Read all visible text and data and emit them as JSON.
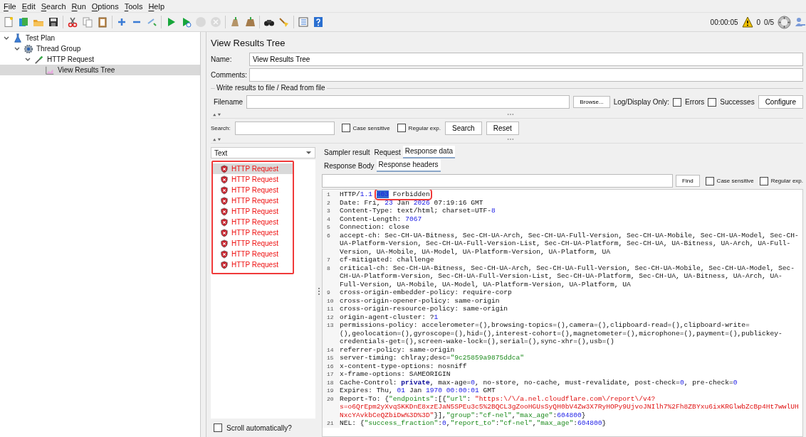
{
  "menu": [
    {
      "label": "File"
    },
    {
      "label": "Edit"
    },
    {
      "label": "Search"
    },
    {
      "label": "Run"
    },
    {
      "label": "Options"
    },
    {
      "label": "Tools"
    },
    {
      "label": "Help"
    }
  ],
  "toolbar_groups": [
    {
      "buttons": [
        {
          "kind": "new",
          "disabled": false
        },
        {
          "kind": "templates",
          "disabled": false
        },
        {
          "kind": "open",
          "disabled": false
        },
        {
          "kind": "save",
          "disabled": false
        }
      ]
    },
    {
      "buttons": [
        {
          "kind": "cut",
          "disabled": false
        },
        {
          "kind": "copy",
          "disabled": false
        },
        {
          "kind": "paste",
          "disabled": false
        }
      ]
    },
    {
      "buttons": [
        {
          "kind": "expand",
          "disabled": false
        },
        {
          "kind": "collapse",
          "disabled": false
        },
        {
          "kind": "toggle",
          "disabled": false
        }
      ]
    },
    {
      "buttons": [
        {
          "kind": "start",
          "disabled": false
        },
        {
          "kind": "start_no_timers",
          "disabled": false
        },
        {
          "kind": "stop",
          "disabled": true
        },
        {
          "kind": "shutdown",
          "disabled": true
        }
      ]
    },
    {
      "buttons": [
        {
          "kind": "clear",
          "disabled": false
        },
        {
          "kind": "clear_all",
          "disabled": false
        }
      ]
    },
    {
      "buttons": [
        {
          "kind": "search",
          "disabled": false
        },
        {
          "kind": "reset_search",
          "disabled": false
        }
      ]
    },
    {
      "buttons": [
        {
          "kind": "functions",
          "disabled": false
        },
        {
          "kind": "help",
          "disabled": false
        }
      ]
    }
  ],
  "status": {
    "elapsed": "00:00:05",
    "warnings": "0",
    "threads": "0/5"
  },
  "tree": [
    {
      "label": "Test Plan",
      "kind": "plan",
      "expanded": true,
      "selected": false,
      "children": [
        {
          "label": "Thread Group",
          "kind": "thread_group",
          "expanded": true,
          "selected": false,
          "children": [
            {
              "label": "HTTP Request",
              "kind": "sampler",
              "expanded": true,
              "selected": false,
              "children": [
                {
                  "label": "View Results Tree",
                  "kind": "listener",
                  "selected": true
                }
              ]
            }
          ]
        }
      ]
    }
  ],
  "panel": {
    "title": "View Results Tree",
    "name_label": "Name:",
    "name_value": "View Results Tree",
    "comments_label": "Comments:",
    "file_group": {
      "legend": "Write results to file / Read from file",
      "filename_label": "Filename",
      "browse": "Browse...",
      "log_label": "Log/Display Only:",
      "options": [
        {
          "label": "Errors",
          "checked": false
        },
        {
          "label": "Successes",
          "checked": false
        }
      ],
      "configure": "Configure"
    },
    "search": {
      "label": "Search:",
      "options": [
        {
          "label": "Case sensitive",
          "checked": false
        },
        {
          "label": "Regular exp.",
          "checked": false
        }
      ],
      "buttons": [
        "Search",
        "Reset"
      ]
    }
  },
  "results": {
    "renderer": "Text",
    "annotated": true,
    "items": [
      {
        "label": "HTTP Request",
        "kind": "error",
        "selected": true
      },
      {
        "label": "HTTP Request",
        "kind": "error",
        "selected": false
      },
      {
        "label": "HTTP Request",
        "kind": "error",
        "selected": false
      },
      {
        "label": "HTTP Request",
        "kind": "error",
        "selected": false
      },
      {
        "label": "HTTP Request",
        "kind": "error",
        "selected": false
      },
      {
        "label": "HTTP Request",
        "kind": "error",
        "selected": false
      },
      {
        "label": "HTTP Request",
        "kind": "error",
        "selected": false
      },
      {
        "label": "HTTP Request",
        "kind": "error",
        "selected": false
      },
      {
        "label": "HTTP Request",
        "kind": "error",
        "selected": false
      },
      {
        "label": "HTTP Request",
        "kind": "error",
        "selected": false
      }
    ],
    "scroll_auto": {
      "label": "Scroll automatically?",
      "checked": false
    }
  },
  "tabs": [
    {
      "label": "Sampler result",
      "selected": false
    },
    {
      "label": "Request",
      "selected": false
    },
    {
      "label": "Response data",
      "selected": true
    }
  ],
  "subtabs": [
    {
      "label": "Response Body",
      "selected": false
    },
    {
      "label": "Response headers",
      "selected": true
    }
  ],
  "find": {
    "button": "Find",
    "options": [
      {
        "label": "Case sensitive",
        "checked": false
      },
      {
        "label": "Regular exp.",
        "checked": false
      }
    ]
  },
  "lines": [
    {
      "number": "1",
      "parts": [
        {
          "kind": "plain",
          "text": "HTTP/"
        },
        {
          "kind": "number",
          "text": "1.1 "
        },
        {
          "kind": "selection",
          "text": "403",
          "boxed": true
        },
        {
          "kind": "plain",
          "text": " Forbidden",
          "boxed": true
        }
      ]
    },
    {
      "number": "2",
      "parts": [
        {
          "kind": "plain",
          "text": "Date: Fri, "
        },
        {
          "kind": "number",
          "text": "23"
        },
        {
          "kind": "plain",
          "text": " Jan "
        },
        {
          "kind": "number",
          "text": "2026"
        },
        {
          "kind": "plain",
          "text": " 07:19:16 GMT"
        }
      ]
    },
    {
      "number": "3",
      "parts": [
        {
          "kind": "plain",
          "text": "Content-Type: text/html; charset=UTF-"
        },
        {
          "kind": "number",
          "text": "8"
        }
      ]
    },
    {
      "number": "4",
      "parts": [
        {
          "kind": "plain",
          "text": "Content-Length: "
        },
        {
          "kind": "number",
          "text": "7067"
        }
      ]
    },
    {
      "number": "5",
      "parts": [
        {
          "kind": "plain",
          "text": "Connection: close"
        }
      ]
    },
    {
      "number": "6",
      "parts": [
        {
          "kind": "plain",
          "text": "accept-ch: Sec-CH-UA-Bitness, Sec-CH-UA-Arch, Sec-CH-UA-Full-Version, Sec-CH-UA-Mobile, Sec-CH-UA-Model, Sec-CH-UA-Platform-Version, Sec-CH-UA-Full-Version-List, Sec-CH-UA-Platform, Sec-CH-UA, UA-Bitness, UA-Arch, UA-Full-Version, UA-Mobile, UA-Model, UA-Platform-Version, UA-Platform, UA"
        }
      ]
    },
    {
      "number": "7",
      "parts": [
        {
          "kind": "plain",
          "text": "cf-mitigated: challenge"
        }
      ]
    },
    {
      "number": "8",
      "parts": [
        {
          "kind": "plain",
          "text": "critical-ch: Sec-CH-UA-Bitness, Sec-CH-UA-Arch, Sec-CH-UA-Full-Version, Sec-CH-UA-Mobile, Sec-CH-UA-Model, Sec-CH-UA-Platform-Version, Sec-CH-UA-Full-Version-List, Sec-CH-UA-Platform, Sec-CH-UA, UA-Bitness, UA-Arch, UA-Full-Version, UA-Mobile, UA-Model, UA-Platform-Version, UA-Platform, UA"
        }
      ]
    },
    {
      "number": "9",
      "parts": [
        {
          "kind": "plain",
          "text": "cross-origin-embedder-policy: require-corp"
        }
      ]
    },
    {
      "number": "10",
      "parts": [
        {
          "kind": "plain",
          "text": "cross-origin-opener-policy: same-origin"
        }
      ]
    },
    {
      "number": "11",
      "parts": [
        {
          "kind": "plain",
          "text": "cross-origin-resource-policy: same-origin"
        }
      ]
    },
    {
      "number": "12",
      "parts": [
        {
          "kind": "plain",
          "text": "origin-agent-cluster: ?"
        },
        {
          "kind": "number",
          "text": "1"
        }
      ]
    },
    {
      "number": "13",
      "parts": [
        {
          "kind": "plain",
          "text": "permissions-policy: accelerometer=(),browsing-topics=(),camera=(),clipboard-read=(),clipboard-write=(),geolocation=(),gyroscope=(),hid=(),interest-cohort=(),magnetometer=(),microphone=(),payment=(),publickey-credentials-get=(),screen-wake-lock=(),serial=(),sync-xhr=(),usb=()"
        }
      ]
    },
    {
      "number": "14",
      "parts": [
        {
          "kind": "plain",
          "text": "referrer-policy: same-origin"
        }
      ]
    },
    {
      "number": "15",
      "parts": [
        {
          "kind": "plain",
          "text": "server-timing: chlray;desc="
        },
        {
          "kind": "string",
          "text": "\"9c25859a9875ddca\""
        }
      ]
    },
    {
      "number": "16",
      "parts": [
        {
          "kind": "plain",
          "text": "x-content-type-options: nosniff"
        }
      ]
    },
    {
      "number": "17",
      "parts": [
        {
          "kind": "plain",
          "text": "x-frame-options: SAMEORIGIN"
        }
      ]
    },
    {
      "number": "18",
      "parts": [
        {
          "kind": "plain",
          "text": "Cache-Control: "
        },
        {
          "kind": "keyword",
          "text": "private"
        },
        {
          "kind": "plain",
          "text": ", max-age="
        },
        {
          "kind": "number",
          "text": "0"
        },
        {
          "kind": "plain",
          "text": ", no-store, no-cache, must-revalidate, post-check="
        },
        {
          "kind": "number",
          "text": "0"
        },
        {
          "kind": "plain",
          "text": ", pre-check="
        },
        {
          "kind": "number",
          "text": "0"
        }
      ]
    },
    {
      "number": "19",
      "parts": [
        {
          "kind": "plain",
          "text": "Expires: Thu, "
        },
        {
          "kind": "number",
          "text": "01"
        },
        {
          "kind": "plain",
          "text": " Jan "
        },
        {
          "kind": "number",
          "text": "1970 "
        },
        {
          "kind": "number",
          "text": "00:00:01"
        },
        {
          "kind": "plain",
          "text": " GMT"
        }
      ]
    },
    {
      "number": "20",
      "parts": [
        {
          "kind": "plain",
          "text": "Report-To: {"
        },
        {
          "kind": "string",
          "text": "\"endpoints\""
        },
        {
          "kind": "plain",
          "text": ":[{"
        },
        {
          "kind": "string",
          "text": "\"url\""
        },
        {
          "kind": "plain",
          "text": ": "
        },
        {
          "kind": "url",
          "text": "\"https:\\/\\/a.nel.cloudflare.com\\/report\\/v4?s=o6QrEpm2yXvqSKKDnE8xzEJaN5SPEu3c5%2BQCL3gZooHGUsSyQH0bV4Zw3X7RyHOPy9UjvoJNIlh7%2Fh8ZBYxu6ixKRGlwbZcBp4Ht7wwlUHNxcYAvkbCeQZbiDw%3D%3D\""
        },
        {
          "kind": "plain",
          "text": "}],"
        },
        {
          "kind": "string",
          "text": "\"group\""
        },
        {
          "kind": "plain",
          "text": ":"
        },
        {
          "kind": "string",
          "text": "\"cf-nel\""
        },
        {
          "kind": "plain",
          "text": ","
        },
        {
          "kind": "string",
          "text": "\"max_age\""
        },
        {
          "kind": "plain",
          "text": ":"
        },
        {
          "kind": "number",
          "text": "604800"
        },
        {
          "kind": "plain",
          "text": "}"
        }
      ]
    },
    {
      "number": "21",
      "parts": [
        {
          "kind": "plain",
          "text": "NEL: {"
        },
        {
          "kind": "string",
          "text": "\"success_fraction\""
        },
        {
          "kind": "plain",
          "text": ":"
        },
        {
          "kind": "number",
          "text": "0"
        },
        {
          "kind": "plain",
          "text": ","
        },
        {
          "kind": "string",
          "text": "\"report_to\""
        },
        {
          "kind": "plain",
          "text": ":"
        },
        {
          "kind": "string",
          "text": "\"cf-nel\""
        },
        {
          "kind": "plain",
          "text": ","
        },
        {
          "kind": "string",
          "text": "\"max_age\""
        },
        {
          "kind": "plain",
          "text": ":"
        },
        {
          "kind": "number",
          "text": "604800"
        },
        {
          "kind": "plain",
          "text": "}"
        }
      ]
    }
  ]
}
